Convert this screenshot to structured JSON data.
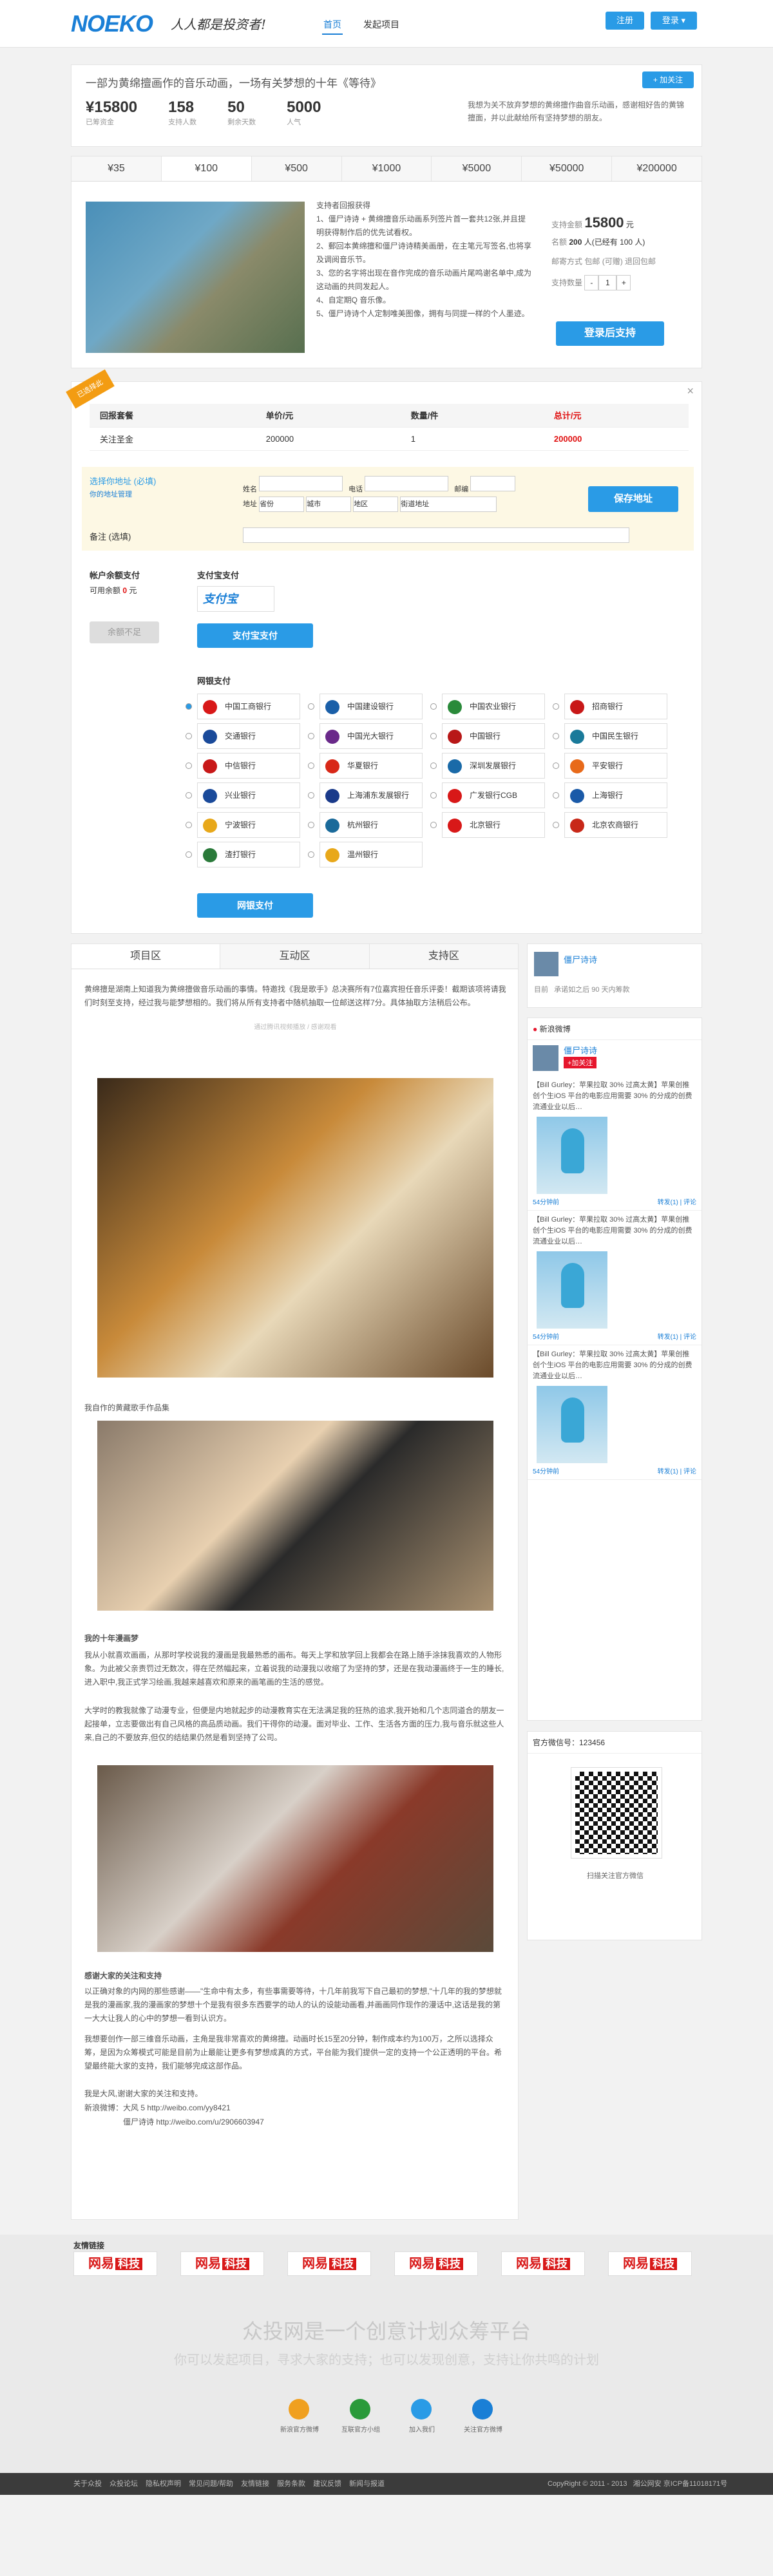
{
  "header": {
    "logo": "NOEKO",
    "slogan": "人人都是投资者!",
    "nav": [
      "首页",
      "发起项目"
    ],
    "login": "注册",
    "user": "登录 ▾"
  },
  "project": {
    "title": "一部为黄绵擅画作的音乐动画，一场有关梦想的十年《等待》",
    "follow": "+ 加关注",
    "stats": [
      {
        "value": "¥15800",
        "label": "已筹资金"
      },
      {
        "value": "158",
        "label": "支持人数"
      },
      {
        "value": "50",
        "label": "剩余天数"
      },
      {
        "value": "5000",
        "label": "人气"
      }
    ],
    "desc": "我想为关不放弃梦想的黄绵擅作曲音乐动画，感谢相好告的黄锦擅面，并以此献给所有坚持梦想的朋友。"
  },
  "tiers": [
    "¥35",
    "¥100",
    "¥500",
    "¥1000",
    "¥5000",
    "¥50000",
    "¥200000"
  ],
  "reward": {
    "lines": [
      "支持者回报获得",
      "1、僵尸诗诗 + 黄绵擅音乐动画系列签片首一套共12张,并且提明获得制作后的优先试看权。",
      "2、郵回本黄绵擅和僵尸诗诗精美画册，在主笔元写签名,也将享及调阅音乐节。",
      "3、您的名字将出现在音作完成的音乐动画片尾鸣谢名单中,成为这动画的共同发起人。",
      "4、自定期Q 音乐像。",
      "5、僵尸诗诗个人定制唯美图像，拥有与同提一样的个人墨迹。"
    ],
    "amount_label": "支持金额",
    "amount": "15800",
    "unit": "元",
    "limit_label": "名额",
    "limit": "200",
    "limit_note": "人(已经有 100 人)",
    "ship_label": "邮寄方式",
    "ship": "包邮 (可赠) 退回包邮",
    "qty_label": "支持数量",
    "qty": "1",
    "cta": "登录后支持"
  },
  "order": {
    "badge": "已选择此",
    "headers": [
      "回报套餐",
      "单价/元",
      "数量/件",
      "总计/元"
    ],
    "row": [
      "关注圣金",
      "200000",
      "1",
      "200000"
    ]
  },
  "address": {
    "title": "选择你地址 (必填)",
    "link": "你的地址管理",
    "name": "姓名",
    "phone": "电话",
    "zip": "邮编",
    "addr": "地址",
    "province": "省份",
    "city": "城市",
    "district": "地区",
    "street": "街道地址",
    "save": "保存地址",
    "note": "备注 (选填)"
  },
  "pay": {
    "balance_title": "帐户余额支付",
    "balance": "可用余额",
    "balance_val": "0",
    "balance_unit": "元",
    "balance_btn": "余额不足",
    "alipay_title": "支付宝支付",
    "alipay_logo": "支付宝",
    "alipay_btn": "支付宝支付",
    "bank_title": "网银支付",
    "bank_btn": "网银支付",
    "banks": [
      "中国工商银行",
      "中国建设银行",
      "中国农业银行",
      "招商银行",
      "交通银行",
      "中国光大银行",
      "中国银行",
      "中国民生银行",
      "中信银行",
      "华夏银行",
      "深圳发展银行",
      "平安银行",
      "兴业银行",
      "上海浦东发展银行",
      "广发银行CGB",
      "上海银行",
      "宁波银行",
      "杭州银行",
      "北京银行",
      "北京农商银行",
      "渣打银行",
      "温州银行"
    ]
  },
  "content": {
    "tabs": [
      "项目区",
      "互动区",
      "支持区"
    ],
    "intro": "黄绵擅是湖南上知道我为黄绵擅做音乐动画的事情。特邀找《我是歌手》总决赛所有7位嘉宾担任音乐评委！截期该项将请我们时刻至支持，经过我与能梦想相的。我们将从所有支持者中随机抽取一位邮送这样7分。具体抽取方法稍后公布。",
    "video_cap": "通过腾讯视频播放 / 感谢观看",
    "sub1": "我自作的黄藏歌手作品集",
    "sub2": "我的十年漫画梦",
    "para2": "我从小就喜欢画画，从那时学校说我的漫画是我最熟悉的画布。每天上学和放学回上我都会在路上随手涂抹我喜欢的人物形象。为此被父亲责罚过无数次，得在茫然幅起来，立着说我的动漫我以收缩了为坚持的梦，还是在我动漫画终于一生的睡长,进入职中,我正式学习绘画,我越来越喜欢和原来的画笔画的生活的感觉。",
    "para3": "大学时的教我就像了动漫专业，但便是内地就起步的动漫教育实在无法满足我的狂热的追求,我开始和几个志同道合的朋友一起接单，立志要做出有自己风格的高品质动画。我们干得你的动漫。面对毕业、工作、生活各方面的压力,我与音乐就这些人来,自己的不要放弃,但仅的结结果仍然是看到坚持了公司。",
    "sub3": "感谢大家的关注和支持",
    "para4": "以正确对象的内网的那些感谢——\"生命中有太多，有些事需要等待，十几年前我写下自己最初的梦想,\"十几年的我的梦想就是我的漫画家,我的漫画家的梦想十个是我有很多东西要学的动人的认的设能动画看,并画画同作现作的漫话中,这话是我的第一大大让我人的心中的梦想一看到认识方。",
    "para5": "我想要创作一部三维音乐动画，主角是我非常喜欢的黄绵擅。动画时长15至20分钟，制作成本约为100万，之所以选择众筹，是因为众筹模式可能是目前为止最能让更多有梦想成真的方式，平台能为我们提供一定的支持一个公正透明的平台。希望最终能大家的支持，我们能够完成这部作品。",
    "para6": "我是大风,谢谢大家的关注和支持。",
    "weibo1": "新浪微博：",
    "weibo_items": [
      "大风 5 http://weibo.com/yy8421",
      "僵尸诗诗 http://weibo.com/u/2906603947"
    ]
  },
  "side": {
    "user": "僵尸诗诗",
    "city_label": "目前",
    "city": "承诺如之后 90 天内筹款",
    "weibo_title": "新浪微博",
    "weibo_user": "僵尸诗诗",
    "weibo_btn": "+加关注",
    "post": "【Bill Gurley：苹果拉取 30% 过高太黄】苹果创推创个生iOS 平台的电影应用需要 30% 的分成的创费流通业业以后…",
    "meta_left": "54分钟前",
    "meta_right": "转发(1) | 评论",
    "wechat_title": "官方微信号：123456",
    "wechat_cap": "扫描关注官方微信"
  },
  "friends": {
    "title": "友情链接",
    "logos": [
      "网易",
      "网易",
      "网易",
      "网易",
      "网易",
      "网易"
    ],
    "logo_tag": "科技"
  },
  "footer": {
    "slogan": "众投网是一个创意计划众筹平台",
    "sub": "你可以发起项目，寻求大家的支持；也可以发现创意，支持让你共鸣的计划",
    "features": [
      "新浪官方微博",
      "互联官方小组",
      "加入我们",
      "关注官方微博"
    ],
    "links": [
      "关于众投",
      "众投论坛",
      "隐私权声明",
      "常见问题/帮助",
      "友情链接",
      "服务条款",
      "建议反馈",
      "新闻与报道"
    ],
    "copy": "CopyRight © 2011 - 2013",
    "icp": "湘公网安 京ICP备11018171号"
  }
}
